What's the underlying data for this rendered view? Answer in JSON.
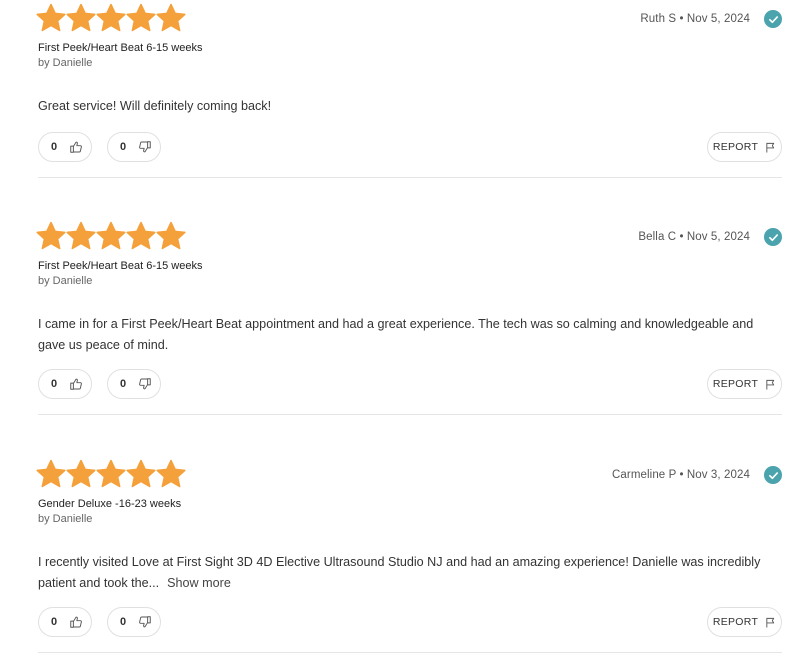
{
  "colors": {
    "star": "#f4a03b",
    "verified": "#4aa3ad"
  },
  "icons": {
    "star": "star-icon",
    "verified": "checkmark-icon",
    "upvote": "thumbs-up-icon",
    "downvote": "thumbs-down-icon",
    "report": "flag-icon"
  },
  "reviews": [
    {
      "rating": 5,
      "author": "Ruth S",
      "date": "Nov 5, 2024",
      "meta": "Ruth S • Nov 5, 2024",
      "service": "First Peek/Heart Beat 6-15 weeks",
      "byline": "by Danielle",
      "body": "Great service! Will definitely coming back!",
      "show_more": "",
      "upvotes": "0",
      "downvotes": "0",
      "report_label": "REPORT"
    },
    {
      "rating": 5,
      "author": "Bella C",
      "date": "Nov 5, 2024",
      "meta": "Bella C • Nov 5, 2024",
      "service": "First Peek/Heart Beat 6-15 weeks",
      "byline": "by Danielle",
      "body": "I came in for a First Peek/Heart Beat appointment and had a great experience. The tech was so calming and knowledgeable and gave us peace of mind.",
      "show_more": "",
      "upvotes": "0",
      "downvotes": "0",
      "report_label": "REPORT"
    },
    {
      "rating": 5,
      "author": "Carmeline P",
      "date": "Nov 3, 2024",
      "meta": "Carmeline P • Nov 3, 2024",
      "service": "Gender Deluxe -16-23 weeks",
      "byline": "by Danielle",
      "body": "I recently visited Love at First Sight 3D 4D Elective Ultrasound Studio NJ and had an amazing experience! Danielle was incredibly patient and took the...",
      "show_more": "Show more",
      "upvotes": "0",
      "downvotes": "0",
      "report_label": "REPORT"
    }
  ]
}
